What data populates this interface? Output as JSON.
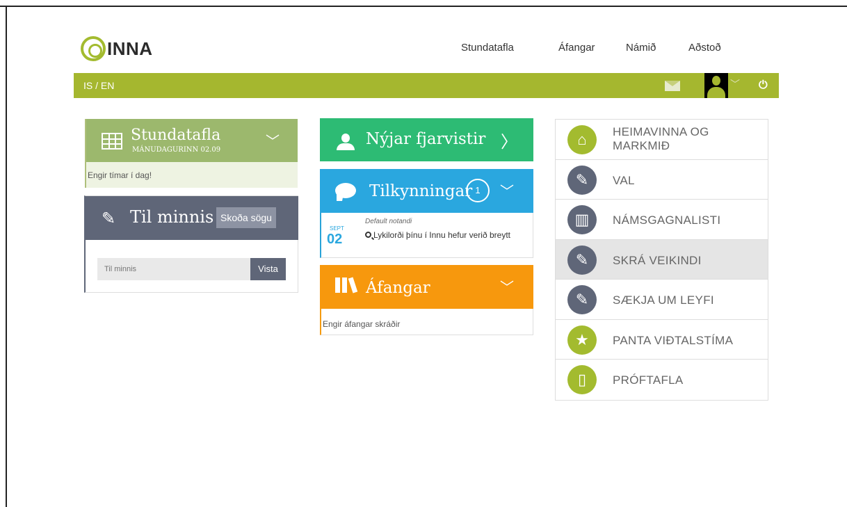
{
  "header": {
    "logo_text": "INNA",
    "nav": [
      "Stundatafla",
      "Áfangar",
      "Námið",
      "Aðstoð"
    ]
  },
  "bar": {
    "lang": "IS / EN",
    "accent": "#a5b72f"
  },
  "stundatafla": {
    "title": "Stundatafla",
    "date": "MÁNUDAGURINN 02.09",
    "empty": "Engir tímar í dag!"
  },
  "minnis": {
    "title": "Til minnis",
    "history_button": "Skoða sögu",
    "placeholder": "Til minnis",
    "save_button": "Vista"
  },
  "fjarvistir": {
    "title": "Nýjar fjarvistir"
  },
  "tilkynningar": {
    "title": "Tilkynningar",
    "count": "1",
    "notice": {
      "month": "SEPT",
      "day": "02",
      "sender": "Default notandi",
      "text": "Lykilorði þínu í Innu hefur verið breytt"
    }
  },
  "afangar": {
    "title": "Áfangar",
    "empty": "Engir áfangar skráðir"
  },
  "quicklinks": [
    {
      "label_line1": "HEIMAVINNA OG",
      "label_line2": "MARKMIÐ",
      "icon": "home-icon",
      "color": "green"
    },
    {
      "label": "VAL",
      "icon": "pencil-icon",
      "color": "dark"
    },
    {
      "label": "NÁMSGAGNALISTI",
      "icon": "books-icon",
      "color": "dark"
    },
    {
      "label": "SKRÁ VEIKINDI",
      "icon": "pencil-icon",
      "color": "dark"
    },
    {
      "label": "SÆKJA UM LEYFI",
      "icon": "pencil-icon",
      "color": "dark"
    },
    {
      "label": "PANTA VIÐTALSTÍMA",
      "icon": "star-icon",
      "color": "green"
    },
    {
      "label": "PRÓFTAFLA",
      "icon": "book-icon",
      "color": "green"
    }
  ]
}
